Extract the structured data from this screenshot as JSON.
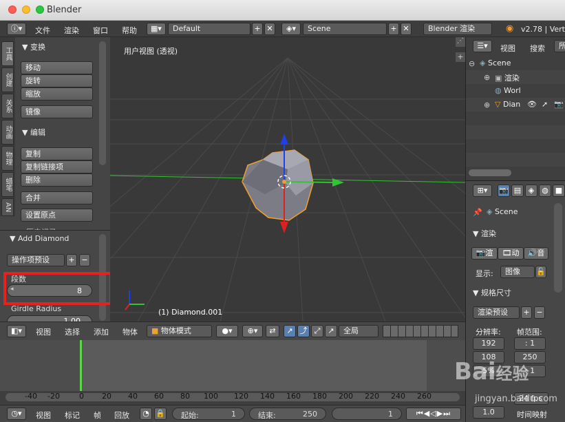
{
  "window": {
    "title": "Blender"
  },
  "info": {
    "menus": [
      "文件",
      "渲染",
      "窗口",
      "帮助"
    ],
    "layout": "Default",
    "scene": "Scene",
    "engine": "Blender 渲染",
    "version": "v2.78 | Vert"
  },
  "tabs": [
    "工具",
    "创建",
    "关系",
    "动画",
    "物理",
    "蜡笔",
    "AN"
  ],
  "tools": {
    "transform_header": "▼ 变换",
    "transform": [
      "移动",
      "旋转",
      "缩放"
    ],
    "mirror": "镜像",
    "edit_header": "▼ 编辑",
    "edit": [
      "复制",
      "复制链接项",
      "删除"
    ],
    "join": "合并",
    "origin": "设置原点",
    "history_partial": "历史记录"
  },
  "operator": {
    "header": "▼ Add Diamond",
    "preset": "操作项预设",
    "segments_label": "段数",
    "segments_value": "8",
    "girdle_label": "Girdle Radius",
    "girdle_value": "1.00"
  },
  "viewport": {
    "title": "用户视图 (透视)",
    "object_label": "(1) Diamond.001"
  },
  "viewheader": {
    "menus": [
      "视图",
      "选择",
      "添加",
      "物体"
    ],
    "mode": "物体模式",
    "pivot": "全局"
  },
  "timeline": {
    "ruler": [
      "-40",
      "-20",
      "0",
      "20",
      "40",
      "60",
      "80",
      "100",
      "120",
      "140",
      "160",
      "180",
      "200",
      "220",
      "240",
      "260"
    ],
    "menus": [
      "视图",
      "标记",
      "帧",
      "回放"
    ],
    "start_label": "起始:",
    "start_value": "1",
    "end_label": "结束:",
    "end_value": "250",
    "current": "1"
  },
  "outliner": {
    "menus": [
      "视图",
      "搜索"
    ],
    "items": [
      "Scene",
      "渲染",
      "Worl",
      "Dian"
    ]
  },
  "properties": {
    "context": "Scene",
    "render_header": "▼ 渲染",
    "render_btns": [
      "渲",
      "动",
      "音"
    ],
    "display_label": "显示:",
    "display_value": "图像",
    "dims_header": "▼ 规格尺寸",
    "preset": "渲染预设",
    "res_label": "分辨率:",
    "frame_label": "帧范围:",
    "res_x": "192",
    "res_y": "108",
    "res_pct": "5%",
    "aspect": "1",
    "frames_start": "1",
    "frames_end": "250",
    "frames_step": "1",
    "fps": "24 fps",
    "time_label": "时间映射",
    "stretch": "1.0"
  },
  "watermark": {
    "line1": "Bai",
    "line2": "经验",
    "url": "jingyan.baidu.com"
  },
  "colors": {
    "x_axis": "#2fc62f",
    "y_axis": "#e02020",
    "z_axis": "#1f3fe8",
    "select": "#f0a030",
    "current_frame": "#5ed64a",
    "highlight": "#e8211f"
  }
}
